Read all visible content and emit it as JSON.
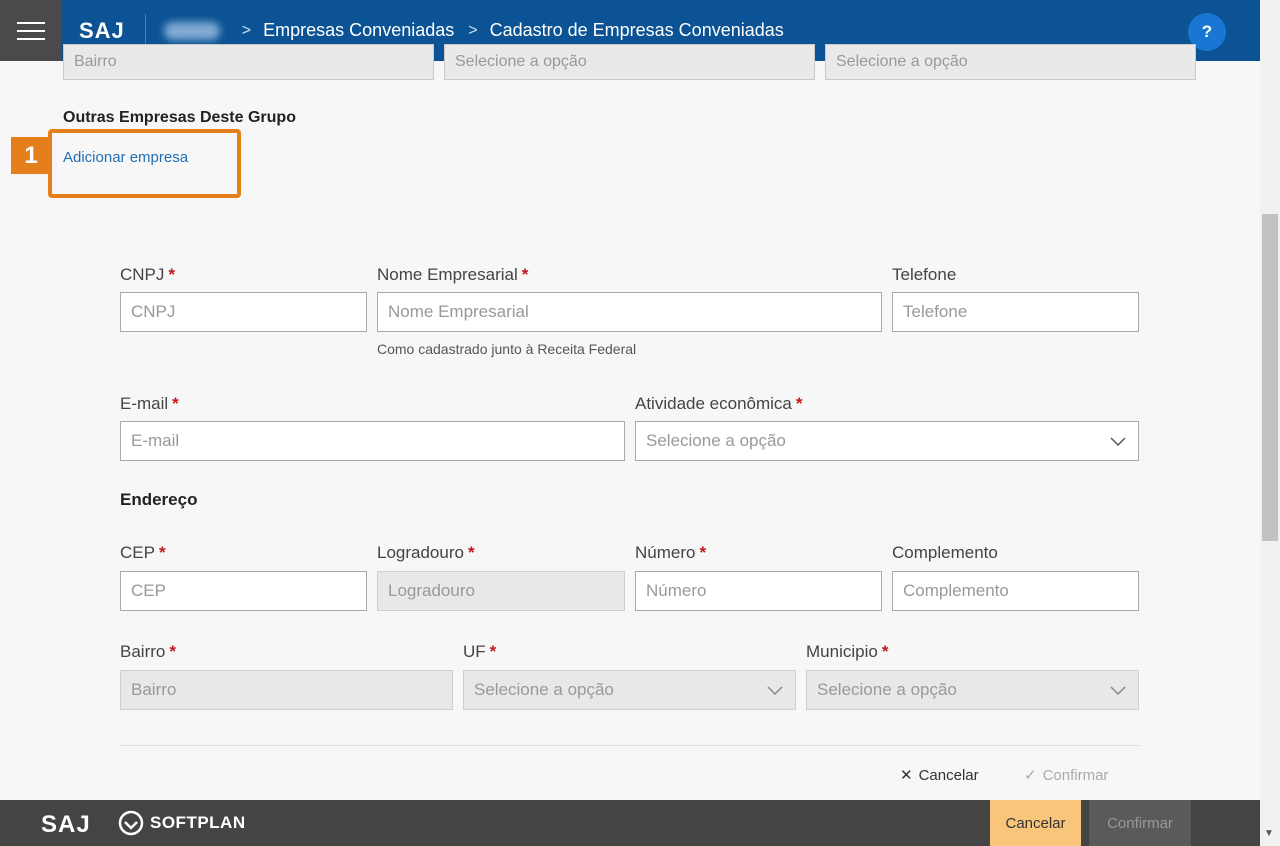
{
  "header": {
    "brand": "SAJ",
    "breadcrumb": [
      "Empresas Conveniadas",
      "Cadastro de Empresas Conveniadas"
    ],
    "help_label": "?"
  },
  "partial_row": {
    "bairro_placeholder": "Bairro",
    "select1_placeholder": "Selecione a opção",
    "select2_placeholder": "Selecione a opção"
  },
  "group": {
    "title": "Outras Empresas Deste Grupo",
    "add_link": "Adicionar empresa",
    "callout_number": "1"
  },
  "form": {
    "cnpj": {
      "label": "CNPJ",
      "placeholder": "CNPJ"
    },
    "nome": {
      "label": "Nome Empresarial",
      "placeholder": "Nome Empresarial",
      "hint": "Como cadastrado junto à Receita Federal"
    },
    "telefone": {
      "label": "Telefone",
      "placeholder": "Telefone"
    },
    "email": {
      "label": "E-mail",
      "placeholder": "E-mail"
    },
    "atividade": {
      "label": "Atividade econômica",
      "placeholder": "Selecione a opção"
    },
    "section_endereco": "Endereço",
    "cep": {
      "label": "CEP",
      "placeholder": "CEP"
    },
    "logradouro": {
      "label": "Logradouro",
      "placeholder": "Logradouro"
    },
    "numero": {
      "label": "Número",
      "placeholder": "Número"
    },
    "complemento": {
      "label": "Complemento",
      "placeholder": "Complemento"
    },
    "bairro": {
      "label": "Bairro",
      "placeholder": "Bairro"
    },
    "uf": {
      "label": "UF",
      "placeholder": "Selecione a opção"
    },
    "municipio": {
      "label": "Municipio",
      "placeholder": "Selecione a opção"
    },
    "required_mark": "*",
    "cancel_label": "Cancelar",
    "confirm_label": "Confirmar"
  },
  "footer": {
    "logo_saj": "SAJ",
    "logo_softplan": "SOFTPLAN",
    "cancel_button": "Cancelar",
    "confirm_button": "Confirmar"
  },
  "colors": {
    "header_bg": "#0b5394",
    "callout": "#e47f1c",
    "link": "#1f6fb5",
    "required": "#c0171d",
    "footer_bg": "#444444",
    "cancel_btn": "#f9c57a"
  }
}
